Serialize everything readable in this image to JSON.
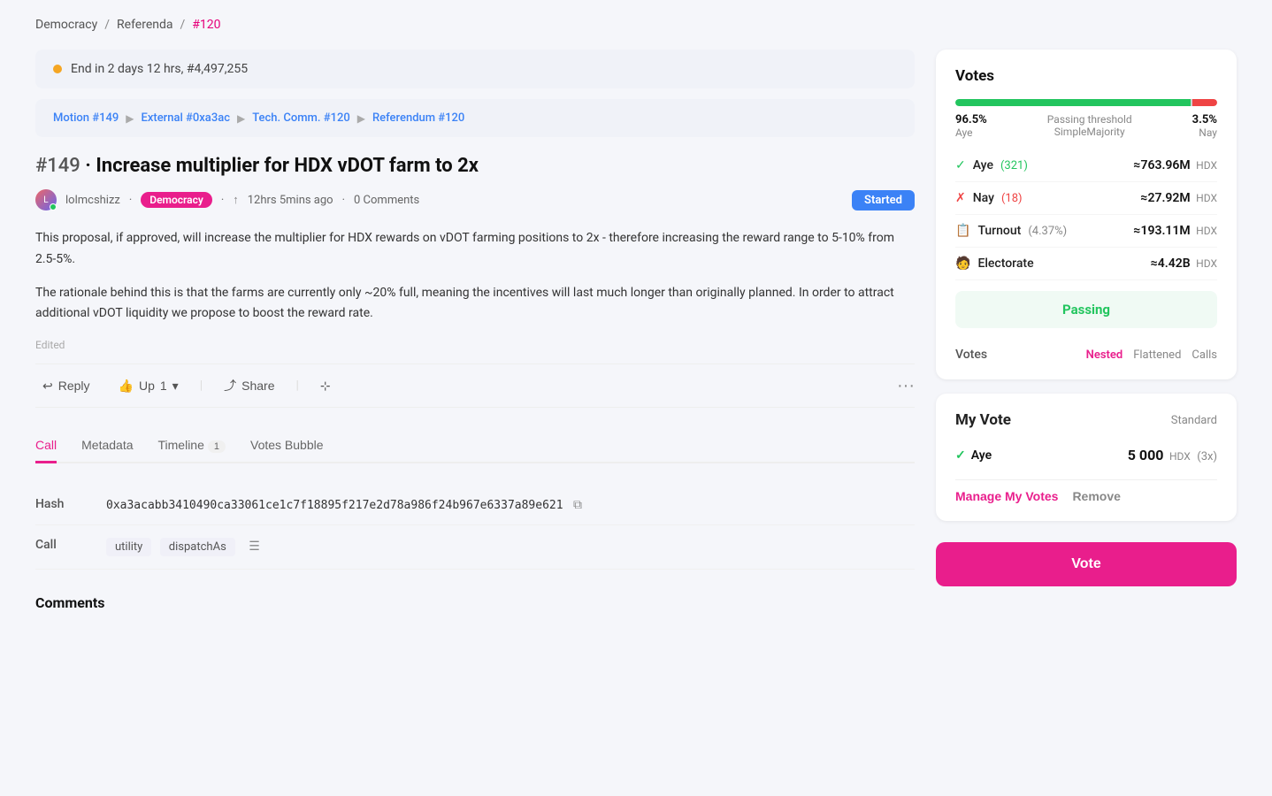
{
  "breadcrumb": {
    "items": [
      "Democracy",
      "Referenda",
      "#120"
    ],
    "separators": [
      "/",
      "/"
    ]
  },
  "timer": {
    "text": "End in 2 days 12 hrs, #4,497,255"
  },
  "chain": {
    "items": [
      "Motion #149",
      "External #0xa3ac",
      "Tech. Comm. #120",
      "Referendum #120"
    ]
  },
  "proposal": {
    "id": "#149",
    "title": "Increase multiplier for HDX vDOT farm to 2x",
    "author": "lolmcshizz",
    "category": "Democracy",
    "time_ago": "12hrs 5mins ago",
    "comments": "0 Comments",
    "status": "Started",
    "body_1": "This proposal, if approved, will increase the multiplier for HDX rewards on vDOT farming positions to 2x - therefore increasing the reward range to 5-10% from 2.5-5%.",
    "body_2": "The rationale behind this is that the farms are currently only ~20% full, meaning the incentives will last much longer than originally planned. In order to attract additional vDOT liquidity we propose to boost the reward rate.",
    "edited_label": "Edited"
  },
  "actions": {
    "reply": "Reply",
    "up_vote": "Up",
    "up_count": "1",
    "share": "Share"
  },
  "tabs": [
    {
      "label": "Call",
      "count": null,
      "active": true
    },
    {
      "label": "Metadata",
      "count": null,
      "active": false
    },
    {
      "label": "Timeline",
      "count": "1",
      "active": false
    },
    {
      "label": "Votes Bubble",
      "count": null,
      "active": false
    }
  ],
  "call_detail": {
    "hash_label": "Hash",
    "hash_value": "0xa3acabb3410490ca33061ce1c7f18895f217e2d78a986f24b967e6337a89e621",
    "call_label": "Call",
    "call_tags": [
      "utility",
      "dispatchAs"
    ]
  },
  "comments_label": "Comments",
  "votes": {
    "title": "Votes",
    "aye_pct": "96.5%",
    "aye_label": "Aye",
    "nay_pct": "3.5%",
    "nay_label": "Nay",
    "threshold_label": "Passing threshold",
    "threshold_type": "SimpleMajority",
    "aye_count": "(321)",
    "aye_amount": "≈763.96M",
    "aye_currency": "HDX",
    "nay_count": "(18)",
    "nay_amount": "≈27.92M",
    "nay_currency": "HDX",
    "turnout_pct": "(4.37%)",
    "turnout_amount": "≈193.11M",
    "turnout_currency": "HDX",
    "electorate_label": "Electorate",
    "electorate_amount": "≈4.42B",
    "electorate_currency": "HDX",
    "passing_text": "Passing",
    "votes_label": "Votes",
    "vote_tabs": [
      "Nested",
      "Flattened",
      "Calls"
    ],
    "active_vote_tab": "Nested"
  },
  "my_vote": {
    "title": "My Vote",
    "type": "Standard",
    "vote_label": "Aye",
    "amount": "5 000",
    "currency": "HDX",
    "multiplier": "(3x)",
    "manage_label": "Manage My Votes",
    "remove_label": "Remove"
  },
  "vote_button": "Vote"
}
